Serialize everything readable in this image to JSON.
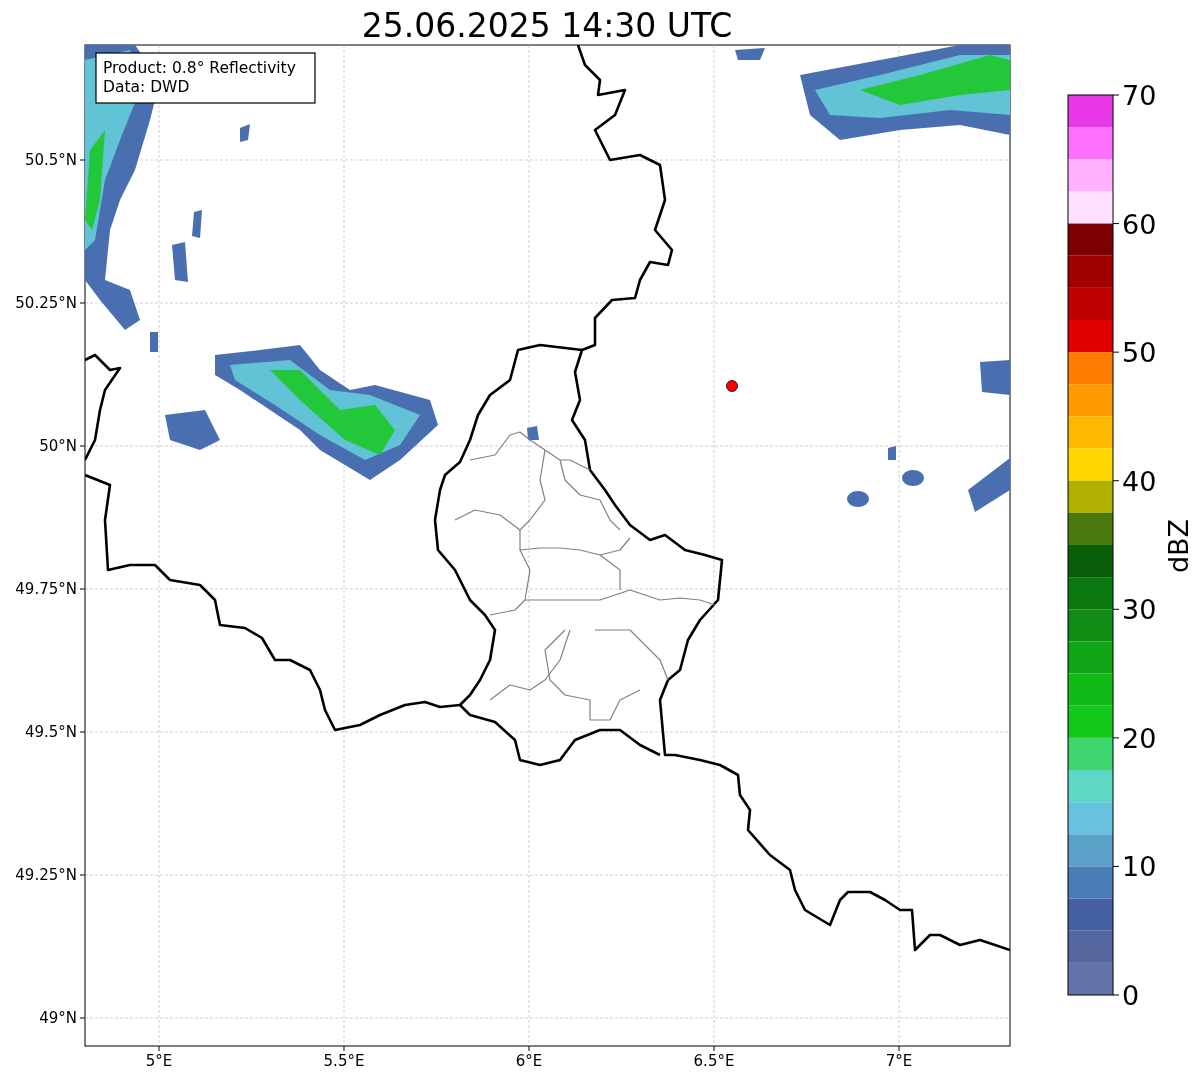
{
  "title": "25.06.2025 14:30 UTC",
  "map": {
    "info_box": [
      "Product: 0.8° Reflectivity",
      "Data: DWD"
    ],
    "x_ticks": [
      "5°E",
      "5.5°E",
      "6°E",
      "6.5°E",
      "7°E"
    ],
    "y_ticks": [
      "50.5°N",
      "50.25°N",
      "50°N",
      "49.75°N",
      "49.5°N",
      "49.25°N",
      "49°N"
    ]
  },
  "colorbar": {
    "label": "dBZ",
    "ticks": [
      "70",
      "60",
      "50",
      "40",
      "30",
      "20",
      "10",
      "0"
    ],
    "bins": [
      {
        "color": "#e838e8"
      },
      {
        "color": "#ff70ff"
      },
      {
        "color": "#ffb0ff"
      },
      {
        "color": "#ffe0ff"
      },
      {
        "color": "#7c0000"
      },
      {
        "color": "#a00000"
      },
      {
        "color": "#c00000"
      },
      {
        "color": "#e00000"
      },
      {
        "color": "#ff7c00"
      },
      {
        "color": "#ff9a00"
      },
      {
        "color": "#ffb800"
      },
      {
        "color": "#ffd700"
      },
      {
        "color": "#b0b000"
      },
      {
        "color": "#4a7a0e"
      },
      {
        "color": "#0a5e0a"
      },
      {
        "color": "#0c7810"
      },
      {
        "color": "#108c14"
      },
      {
        "color": "#10a618"
      },
      {
        "color": "#10bb18"
      },
      {
        "color": "#12c91a"
      },
      {
        "color": "#3dd56e"
      },
      {
        "color": "#5ed8c5"
      },
      {
        "color": "#68c4de"
      },
      {
        "color": "#5aa0c8"
      },
      {
        "color": "#4a7db5"
      },
      {
        "color": "#4560a2"
      },
      {
        "color": "#5667a0"
      },
      {
        "color": "#6474a8"
      }
    ]
  }
}
